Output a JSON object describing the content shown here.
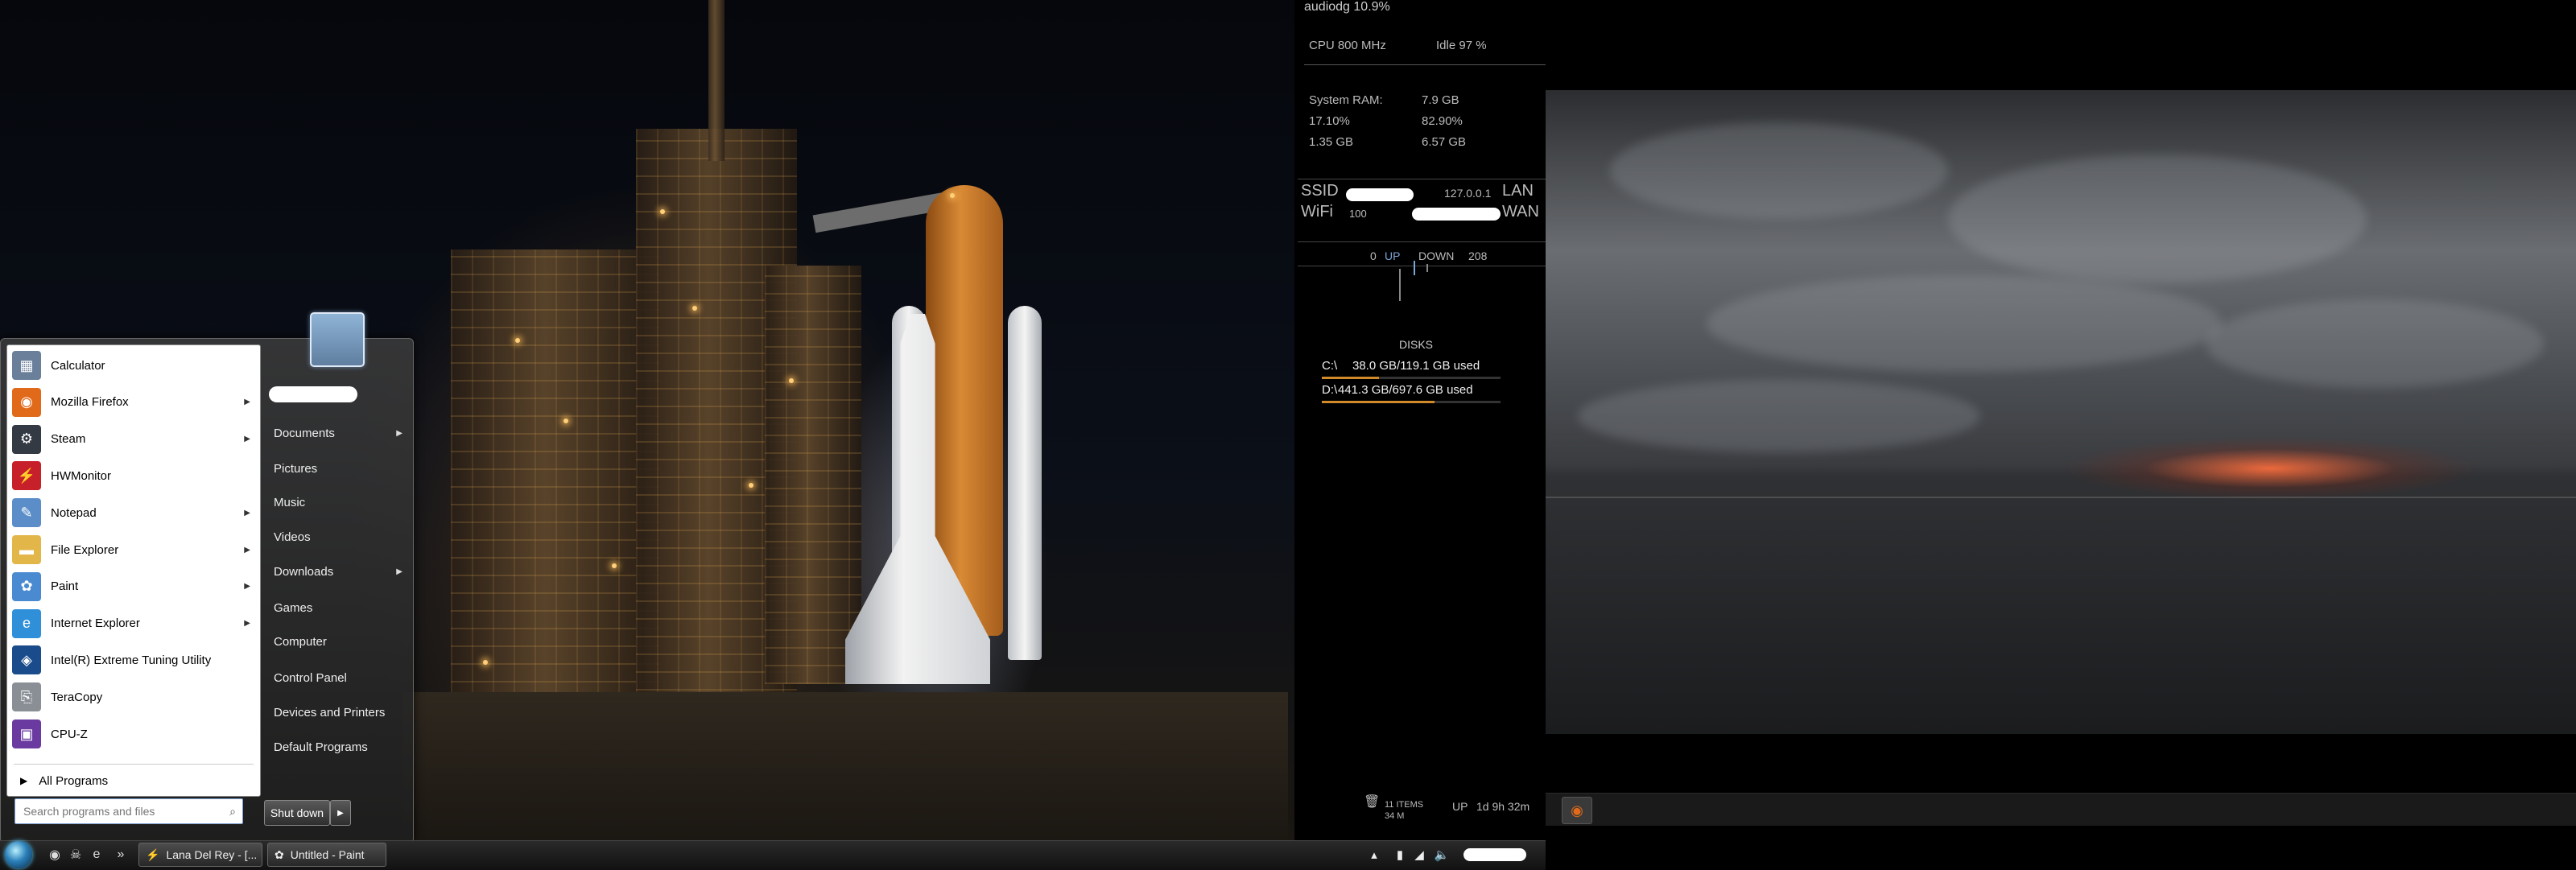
{
  "colors": {
    "start_menu_bg": "#1e1e1e",
    "accent_orange": "#d08a2a",
    "taskbar_bg": "#111111",
    "search_border": "#7a9ccf"
  },
  "rainmeter": {
    "top_process": "audiodg 10.9%",
    "cpu_speed": "CPU 800 MHz",
    "cpu_idle": "Idle 97 %",
    "ram_label": "System RAM:",
    "ram_total": "7.9 GB",
    "ram_used_pct": "17.10%",
    "ram_free_pct": "82.90%",
    "ram_used": "1.35 GB",
    "ram_free": "6.57 GB",
    "ssid_label": "SSID",
    "wifi_label": "WiFi",
    "wifi_value": "100",
    "lan_ip": "127.0.0.1",
    "lan_label": "LAN",
    "wan_label": "WAN",
    "up_value": "0",
    "up_label": "UP",
    "down_label": "DOWN",
    "down_value": "208",
    "disks_title": "DISKS",
    "disks": [
      {
        "name": "C:\\",
        "usage": "38.0 GB/119.1 GB used",
        "fill": 0.32
      },
      {
        "name": "D:\\",
        "usage": "441.3 GB/697.6 GB used",
        "fill": 0.63
      }
    ],
    "recycle_items": "11 ITEMS",
    "recycle_size": "34 M",
    "uptime_label": "UP",
    "uptime_value": "1d 9h 32m"
  },
  "start_menu": {
    "apps": [
      {
        "label": "Calculator",
        "icon": "calculator-icon",
        "glyph": "▦",
        "color": "#6a7f9a",
        "arrow": false
      },
      {
        "label": "Mozilla Firefox",
        "icon": "firefox-icon",
        "glyph": "◉",
        "color": "#e06a1a",
        "arrow": true
      },
      {
        "label": "Steam",
        "icon": "steam-icon",
        "glyph": "⚙",
        "color": "#333a44",
        "arrow": true
      },
      {
        "label": "HWMonitor",
        "icon": "hwmonitor-icon",
        "glyph": "⚡",
        "color": "#c8202a",
        "arrow": false
      },
      {
        "label": "Notepad",
        "icon": "notepad-icon",
        "glyph": "✎",
        "color": "#5b8ec9",
        "arrow": true
      },
      {
        "label": "File Explorer",
        "icon": "folder-icon",
        "glyph": "▬",
        "color": "#e3b64a",
        "arrow": true
      },
      {
        "label": "Paint",
        "icon": "paint-icon",
        "glyph": "✿",
        "color": "#4a8ad0",
        "arrow": true
      },
      {
        "label": "Internet Explorer",
        "icon": "internet-explorer-icon",
        "glyph": "e",
        "color": "#2f8fd8",
        "arrow": true
      },
      {
        "label": "Intel(R) Extreme Tuning Utility",
        "icon": "intel-xtu-icon",
        "glyph": "◈",
        "color": "#1a4b8a",
        "arrow": false
      },
      {
        "label": "TeraCopy",
        "icon": "teracopy-icon",
        "glyph": "⎘",
        "color": "#8a8f96",
        "arrow": false
      },
      {
        "label": "CPU-Z",
        "icon": "cpuz-icon",
        "glyph": "▣",
        "color": "#6b3aa0",
        "arrow": false
      }
    ],
    "all_programs": "All Programs",
    "search_placeholder": "Search programs and files",
    "places": [
      {
        "label": "Documents",
        "arrow": true
      },
      {
        "label": "Pictures",
        "arrow": false
      },
      {
        "label": "Music",
        "arrow": false
      },
      {
        "label": "Videos",
        "arrow": false
      },
      {
        "label": "Downloads",
        "arrow": true
      },
      {
        "label": "Games",
        "arrow": false
      },
      {
        "label": "Computer",
        "arrow": false
      },
      {
        "label": "Control Panel",
        "arrow": false
      },
      {
        "label": "Devices and Printers",
        "arrow": false
      },
      {
        "label": "Default Programs",
        "arrow": false
      }
    ],
    "shutdown_label": "Shut down"
  },
  "taskbar": {
    "quick_launch": [
      {
        "icon": "firefox-icon",
        "glyph": "◉"
      },
      {
        "icon": "alien-icon",
        "glyph": "☠"
      },
      {
        "icon": "internet-explorer-icon",
        "glyph": "e"
      },
      {
        "icon": "more-chevron-icon",
        "glyph": "»"
      }
    ],
    "tasks": [
      {
        "label": "Lana Del Rey - [...",
        "icon": "winamp-icon",
        "glyph": "⚡"
      },
      {
        "label": "Untitled - Paint",
        "icon": "paint-icon",
        "glyph": "✿"
      }
    ],
    "tray": [
      {
        "icon": "show-hidden-icons-icon",
        "glyph": "▴"
      },
      {
        "icon": "power-icon",
        "glyph": "▮"
      },
      {
        "icon": "network-icon",
        "glyph": "◢"
      },
      {
        "icon": "speaker-icon",
        "glyph": "🔈"
      }
    ]
  }
}
